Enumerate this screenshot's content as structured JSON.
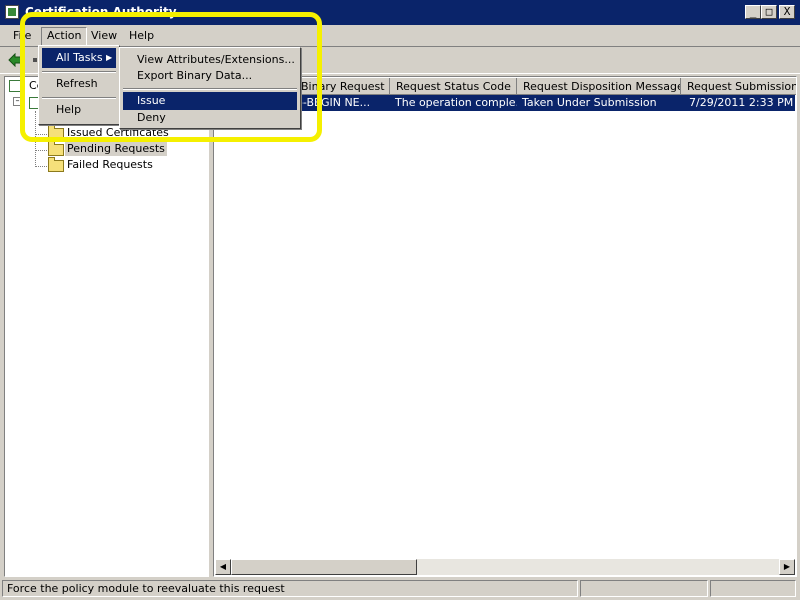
{
  "window": {
    "title": "Certification Authority",
    "controls": {
      "minimize": "_",
      "maximize": "□",
      "close": "X"
    }
  },
  "menubar": {
    "file": "File",
    "action": "Action",
    "view": "View",
    "help": "Help"
  },
  "action_menu": {
    "items": [
      {
        "label": "All Tasks",
        "arrow": "▶"
      },
      {
        "label": "Refresh"
      },
      {
        "label": "Help"
      }
    ]
  },
  "all_tasks_submenu": {
    "items": [
      {
        "label": "View Attributes/Extensions..."
      },
      {
        "label": "Export Binary Data..."
      },
      {
        "label": "Issue",
        "selected": true
      },
      {
        "label": "Deny"
      }
    ]
  },
  "tree": {
    "root_label": "Ce",
    "items": [
      {
        "label": "Issued Certificates"
      },
      {
        "label": "Pending Requests",
        "selected": true
      },
      {
        "label": "Failed Requests"
      }
    ]
  },
  "list": {
    "columns": [
      "Binary Request",
      "Request Status Code",
      "Request Disposition Message",
      "Request Submission Da"
    ],
    "rows": [
      [
        "-----BEGIN NE...",
        "The operation comple...",
        "Taken Under Submission",
        "7/29/2011 2:33 PM"
      ]
    ]
  },
  "scrollbar": {
    "left_arrow": "◀",
    "right_arrow": "▶"
  },
  "statusbar": {
    "message": "Force the policy module to reevaluate this request"
  },
  "colors": {
    "highlight": "#f5f000",
    "selection": "#0a246a",
    "titlebar": "#0a246a",
    "chrome": "#d4d0c8"
  }
}
